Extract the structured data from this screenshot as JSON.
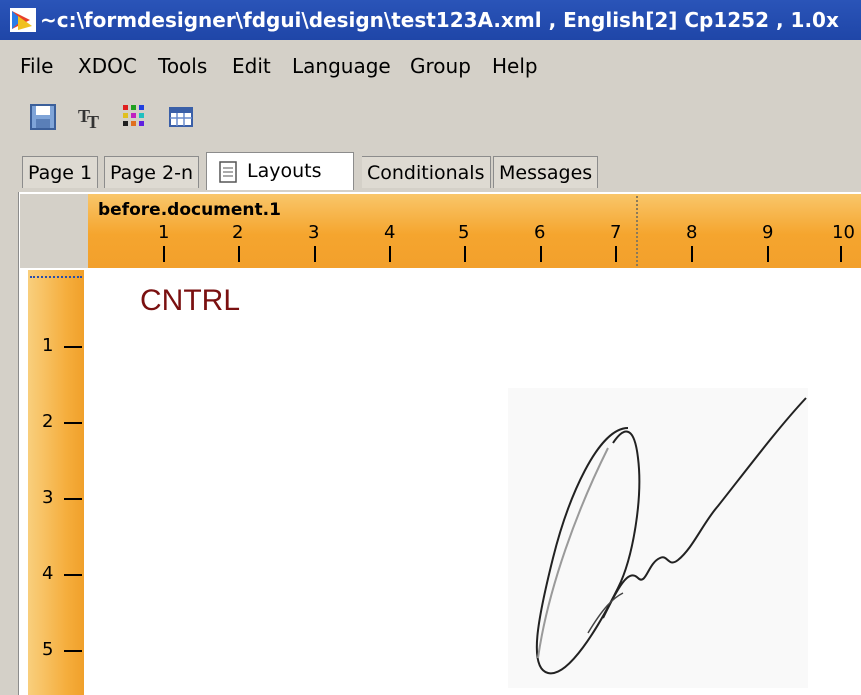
{
  "window": {
    "title": "~c:\\formdesigner\\fdgui\\design\\test123A.xml , English[2] Cp1252 , 1.0x",
    "app_icon": "formdesigner-app-icon"
  },
  "menu": [
    "File",
    "XDOC",
    "Tools",
    "Edit",
    "Language",
    "Group",
    "Help"
  ],
  "toolbar": [
    {
      "name": "save-icon"
    },
    {
      "name": "font-icon"
    },
    {
      "name": "color-grid-icon"
    },
    {
      "name": "table-icon"
    }
  ],
  "tabs": [
    {
      "label": "Page 1",
      "active": false
    },
    {
      "label": "Page 2-n",
      "active": false
    },
    {
      "label": "Layouts",
      "active": true,
      "icon": "document-icon"
    },
    {
      "label": "Conditionals",
      "active": false
    },
    {
      "label": "Messages",
      "active": false
    }
  ],
  "ruler": {
    "layout_name": "before.document.1",
    "h_ticks": [
      "1",
      "2",
      "3",
      "4",
      "5",
      "6",
      "7",
      "8",
      "9",
      "10"
    ],
    "v_ticks": [
      "1",
      "2",
      "3",
      "4",
      "5"
    ],
    "color": "#f5a52e"
  },
  "page": {
    "field_text": "CNTRL",
    "field_color": "#7a1010",
    "signature": "handwritten-signature-image"
  }
}
